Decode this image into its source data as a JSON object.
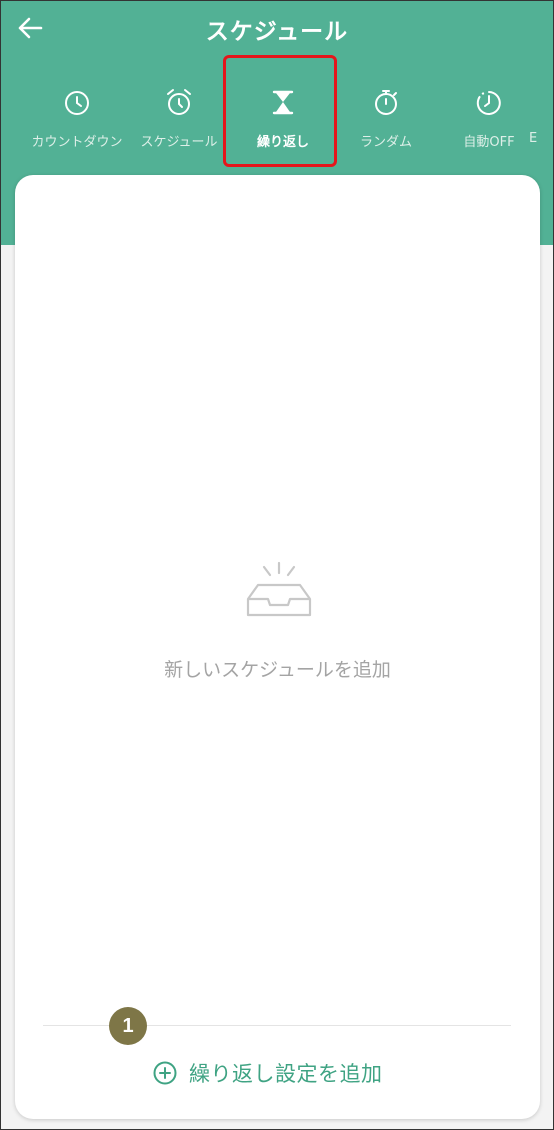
{
  "header": {
    "title": "スケジュール",
    "back_icon": "arrow-left-icon"
  },
  "tabs": [
    {
      "label": "カウントダウン",
      "icon": "clock-icon",
      "active": false
    },
    {
      "label": "スケジュール",
      "icon": "alarm-clock-icon",
      "active": false
    },
    {
      "label": "繰り返し",
      "icon": "hourglass-icon",
      "active": true
    },
    {
      "label": "ランダム",
      "icon": "stopwatch-icon",
      "active": false
    },
    {
      "label": "自動OFF",
      "icon": "timer-icon",
      "active": false
    },
    {
      "label": "E",
      "icon": "",
      "active": false
    }
  ],
  "main": {
    "empty_icon": "empty-inbox-icon",
    "empty_text": "新しいスケジュールを追加",
    "badge": "1",
    "add_label": "繰り返し設定を追加",
    "add_icon": "plus-circle-icon"
  },
  "colors": {
    "accent": "#52b195",
    "highlight": "#e5151b",
    "badge": "#7e7647",
    "add_text": "#3fa383"
  }
}
